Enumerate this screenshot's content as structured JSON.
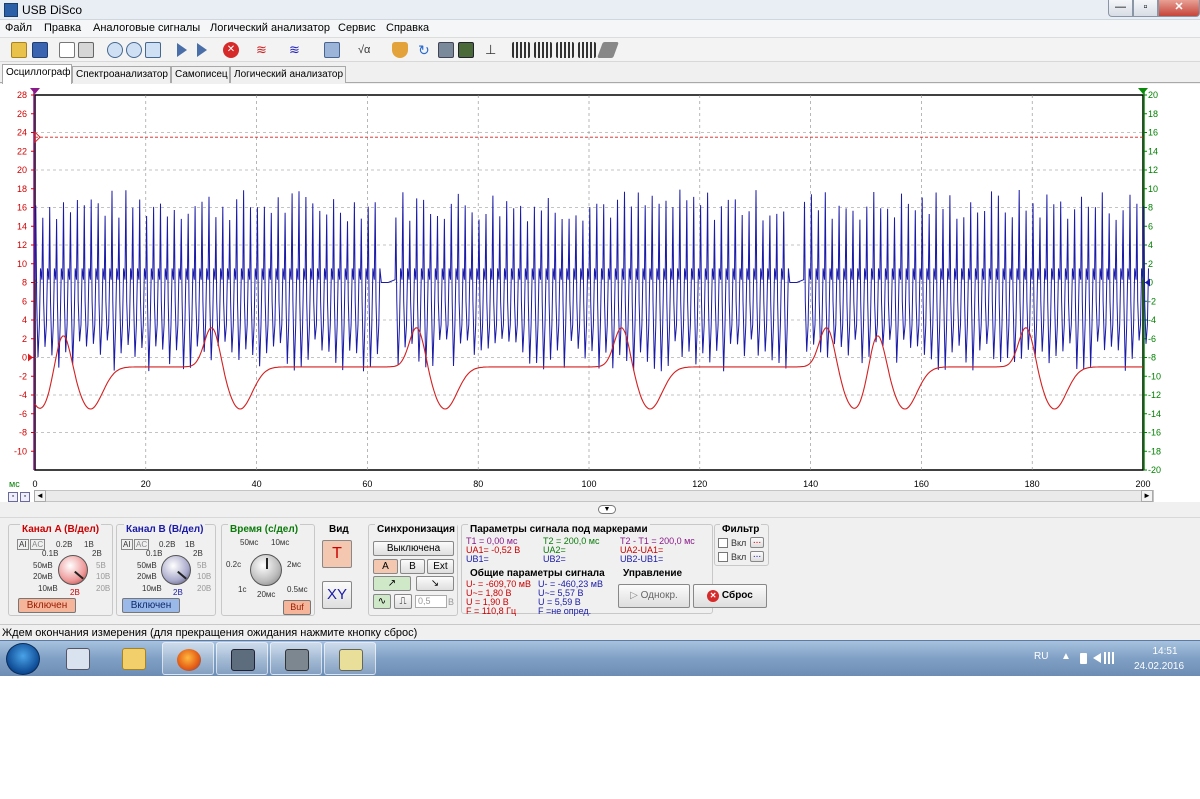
{
  "window": {
    "title": "USB DiSco",
    "min": "—",
    "max": "▫",
    "close": "✕"
  },
  "menu": [
    "Файл",
    "Правка",
    "Аналоговые сигналы",
    "Логический анализатор",
    "Сервис",
    "Справка"
  ],
  "tabs": [
    "Осциллограф",
    "Спектроанализатор",
    "Самописец",
    "Логический анализатор"
  ],
  "scope": {
    "left_axis": [
      "28",
      "26",
      "24",
      "22",
      "20",
      "18",
      "16",
      "14",
      "12",
      "10",
      "8",
      "6",
      "4",
      "2",
      "0",
      "-2",
      "-4",
      "-6",
      "-8",
      "-10"
    ],
    "right_axis": [
      "20",
      "18",
      "16",
      "14",
      "12",
      "10",
      "8",
      "6",
      "4",
      "2",
      "0",
      "-2",
      "-4",
      "-6",
      "-8",
      "-10",
      "-12",
      "-14",
      "-16",
      "-18",
      "-20"
    ],
    "x_unit": "мс",
    "x_axis": [
      "0",
      "20",
      "40",
      "60",
      "80",
      "100",
      "120",
      "140",
      "160",
      "180",
      "200"
    ],
    "left_axis_color": "#d00000",
    "right_axis_color": "#008000",
    "channel_a_color": "#d42020",
    "channel_b_color": "#1a1aa8",
    "x_range_ms": [
      0,
      200
    ],
    "left_range_v": [
      -12,
      28
    ],
    "right_range_v": [
      -20,
      20
    ],
    "channel_a_baseline_v": -1,
    "channel_a_dips_ms": [
      1,
      10,
      37,
      74,
      111,
      148,
      157,
      184
    ],
    "channel_b_silent_ms": [
      [
        62.5,
        64.5
      ],
      [
        136,
        138.5
      ]
    ]
  },
  "channel_a": {
    "title": "Канал A (В/дел)",
    "labels": [
      "0.2В",
      "1В",
      "0.1В",
      "2В",
      "50мВ",
      "5В",
      "20мВ",
      "10В",
      "10мВ",
      "20В"
    ],
    "range": "2В",
    "ai": "AI",
    "ac": "AC",
    "button": "Включен"
  },
  "channel_b": {
    "title": "Канал B (В/дел)",
    "labels": [
      "0.2В",
      "1В",
      "0.1В",
      "2В",
      "50мВ",
      "5В",
      "20мВ",
      "10В",
      "10мВ",
      "20В"
    ],
    "range": "2В",
    "ai": "AI",
    "ac": "AC",
    "button": "Включен"
  },
  "time": {
    "title": "Время (с/дел)",
    "labels": [
      "50мс",
      "10мс",
      "0.2с",
      "2мс",
      "1с",
      "0.5мс"
    ],
    "value": "20мс",
    "buf": "Buf"
  },
  "view": {
    "title": "Вид",
    "t": "T",
    "xy": "XY"
  },
  "sync": {
    "title": "Синхронизация",
    "mode": "Выключена",
    "a": "A",
    "b": "B",
    "ext": "Ext",
    "level": "0,5",
    "unit": "В"
  },
  "markers": {
    "title": "Параметры сигнала под маркерами",
    "t1": "T1 = 0,00 мс",
    "ua1": "UA1= -0,52 В",
    "ub1": "UB1=",
    "t2": "T2 = 200,0 мс",
    "ua2": "UA2=",
    "ub2": "UB2=",
    "dt": "T2 - T1 = 200,0 мс",
    "dua": "UA2-UA1=",
    "dub": "UB2-UB1="
  },
  "general": {
    "title": "Общие параметры сигнала",
    "a": [
      "U- = -609,70 мВ",
      "U~= 1,80 В",
      "U = 1,90 В",
      "F = 110,8 Гц"
    ],
    "b": [
      "U- = -460,23 мВ",
      "U~= 5,57 В",
      "U = 5,59 В",
      "F =не опред."
    ]
  },
  "filter": {
    "title": "Фильтр",
    "on": "Вкл",
    "more": "..."
  },
  "control": {
    "title": "Управление",
    "single": "Однокр.",
    "reset": "Сброс"
  },
  "status": "Ждем окончания измерения (для прекращения ожидания нажмите кнопку сброс)",
  "tray": {
    "lang": "RU",
    "time": "14:51",
    "date": "24.02.2016"
  }
}
